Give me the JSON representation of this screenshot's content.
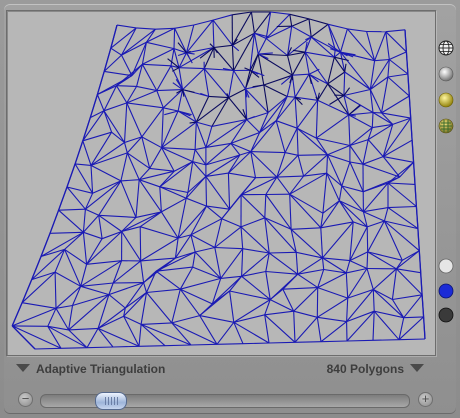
{
  "mode": {
    "label": "Adaptive Triangulation"
  },
  "polygons": {
    "label": "840 Polygons"
  },
  "slider": {
    "value_fraction": 0.16
  },
  "side_icons": [
    {
      "name": "wireframe-globe-icon"
    },
    {
      "name": "gray-sphere-icon"
    },
    {
      "name": "yellow-sphere-icon"
    },
    {
      "name": "textured-sphere-icon"
    }
  ],
  "color_swatches": [
    "#e6e6e6",
    "#1b2bd6",
    "#3a3a3a"
  ],
  "colors": {
    "viewport_bg": "#b7b7b7",
    "wire": "#1a1ab4",
    "wire_dark": "#0b0b5e"
  }
}
